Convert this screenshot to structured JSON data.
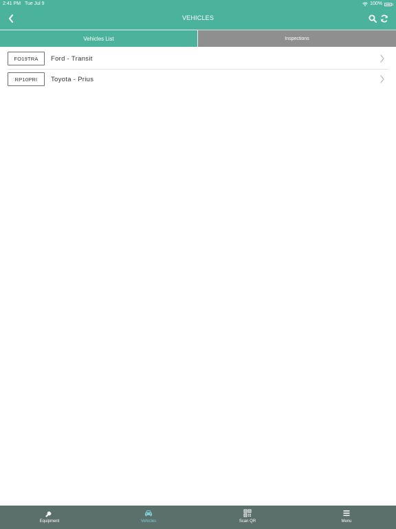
{
  "status_bar": {
    "time": "2:41 PM",
    "date": "Tue Jul 9",
    "battery": "100%"
  },
  "header": {
    "title": "VEHICLES"
  },
  "tabs": [
    {
      "label": "Vehicles List",
      "active": true
    },
    {
      "label": "Inspections",
      "active": false
    }
  ],
  "vehicles": [
    {
      "plate": "FO19TRA",
      "name": "Ford - Transit"
    },
    {
      "plate": "RP10PRI",
      "name": "Toyota - Prius"
    }
  ],
  "tabbar": [
    {
      "label": "Equipment",
      "icon": "wrench-icon"
    },
    {
      "label": "Vehicles",
      "icon": "car-icon",
      "active": true
    },
    {
      "label": "Scan QR",
      "icon": "qr-icon"
    },
    {
      "label": "Menu",
      "icon": "menu-icon"
    }
  ],
  "colors": {
    "primary": "#4bb39c",
    "inactive_tab": "#8f8f8f",
    "tabbar_bg": "#5b6f6b",
    "tabbar_active": "#7ecfd8"
  }
}
